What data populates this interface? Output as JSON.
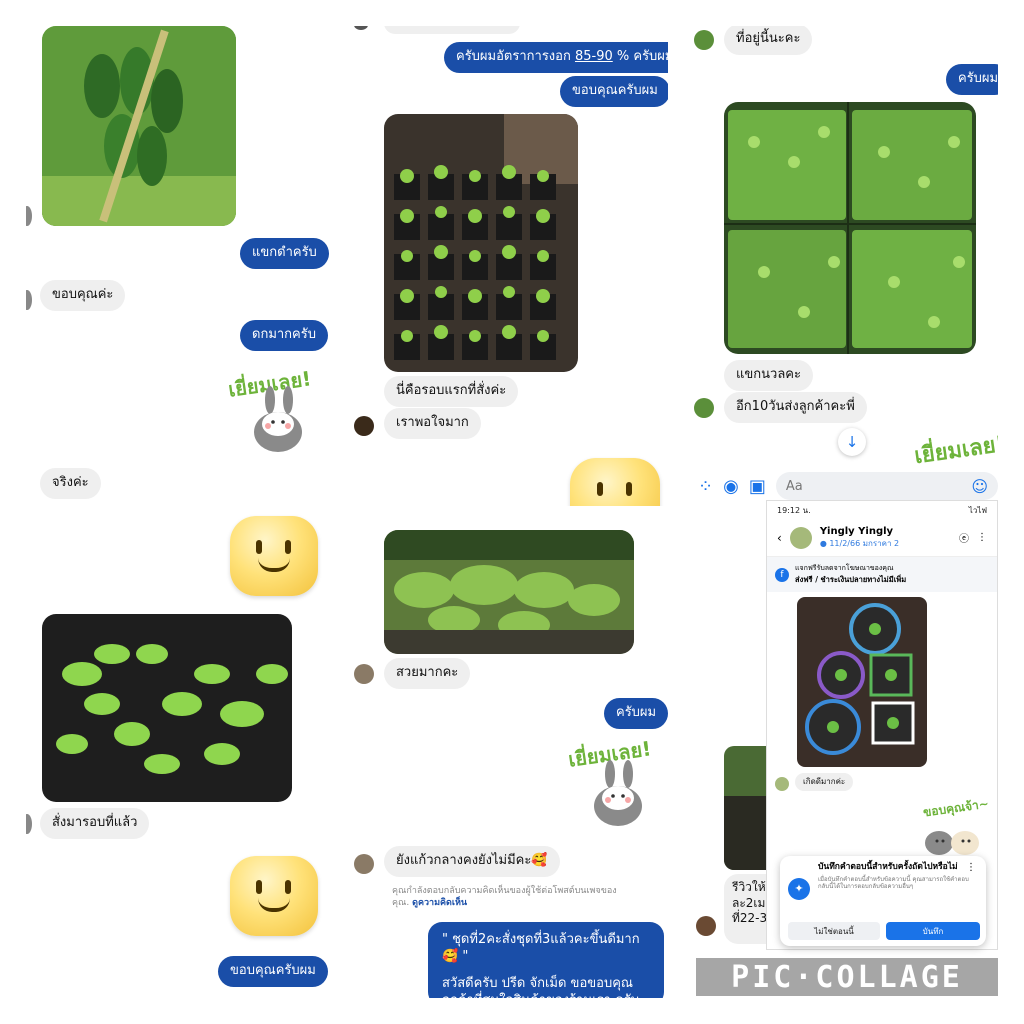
{
  "panel1": {
    "bubble_thanks_black": "แขกดำครับ",
    "bubble_thank_you": "ขอบคุณค่ะ",
    "bubble_lots_of_fruit": "ดกมากครับ",
    "sticker_text": "เยี่ยมเลย!",
    "bubble_really": "จริงค่ะ"
  },
  "panel2": {
    "bubble_germination_prefix": "ครับผมอัตราการงอก ",
    "bubble_germination_rate": "85-90",
    "bubble_germination_suffix": " % ครับผม",
    "bubble_thanks": "ขอบคุณครับผม",
    "bubble_first_round": "นี่คือรอบแรกที่สั่งค่ะ",
    "bubble_very_satisfied": "เราพอใจมาก"
  },
  "panel3": {
    "bubble_here": "ที่อยู่นี้นะคะ",
    "bubble_yes": "ครับผม",
    "bubble_black_kernel": "แขกนวลคะ",
    "bubble_ten_days": "อีก10วันส่งลูกค้าคะพี่",
    "sticker_text": "เยี่ยมเลย!",
    "composer_placeholder": "Aa"
  },
  "panel4": {
    "bubble_ordered_round": "สั่งมารอบที่แล้ว",
    "bubble_thanks": "ขอบคุณครับผม"
  },
  "panel5": {
    "bubble_very_pretty": "สวยมากคะ",
    "bubble_yes": "ครับผม",
    "sticker_text": "เยี่ยมเลย!",
    "bubble_still_not_sprouted": "ยังแก้วกลางคงยังไม่มีคะ🥰",
    "reply_note": "คุณกำลังตอบกลับความคิดเห็นของผู้ใช้ต่อโพสต์บนเพจของ",
    "reply_note_2": "คุณ.",
    "reply_note_link": "ดูความคิดเห็น",
    "quote_text": "\" ชุดที่2คะสั่งชุดที่3แล้วคะขึ้นดีมาก🥰 \"",
    "reply_text": "สวัสดีครับ ปรีด จักเม็ด ขอขอบคุณลูกค้าที่สนใจสินค้าของร้านเรา ครับผม"
  },
  "panel6": {
    "status_time": "19:12 น.",
    "status_right": "ไวไฟ",
    "contact_name": "Yingly Yingly",
    "contact_sub": "● 11/2/66 มกราคา 2",
    "notice_line1": "แจกฟรีรับลดจากโฆษณาของคุณ",
    "notice_line2": "ส่งฟรี / ชำระเงินปลายทางไม่มีเพิ่ม",
    "bubble_sprouted": "เกิดดีมากค่ะ",
    "sticker_text": "ขอบคุณจ้า~",
    "review_text_1": "รีวิวให้",
    "review_text_2": "ละ2เม",
    "review_text_3": "ที่22-3",
    "popup_title": "บันทึกคำตอบนี้สำหรับครั้งถัดไปหรือไม่",
    "popup_desc": "เมื่อบันทึกคำตอบนี้สำหรับข้อความนี้ คุณสามารถใช้คำตอบกลับนี้ได้ในการตอบกลับข้อความอื่นๆ",
    "popup_no": "ไม่ใช่ตอนนี้",
    "popup_save": "บันทึก"
  },
  "watermark": "PIC·COLLAGE",
  "colors": {
    "messenger_blue": "#1a4ea8",
    "incoming_gray": "#efefef",
    "accent": "#1a73e8"
  }
}
